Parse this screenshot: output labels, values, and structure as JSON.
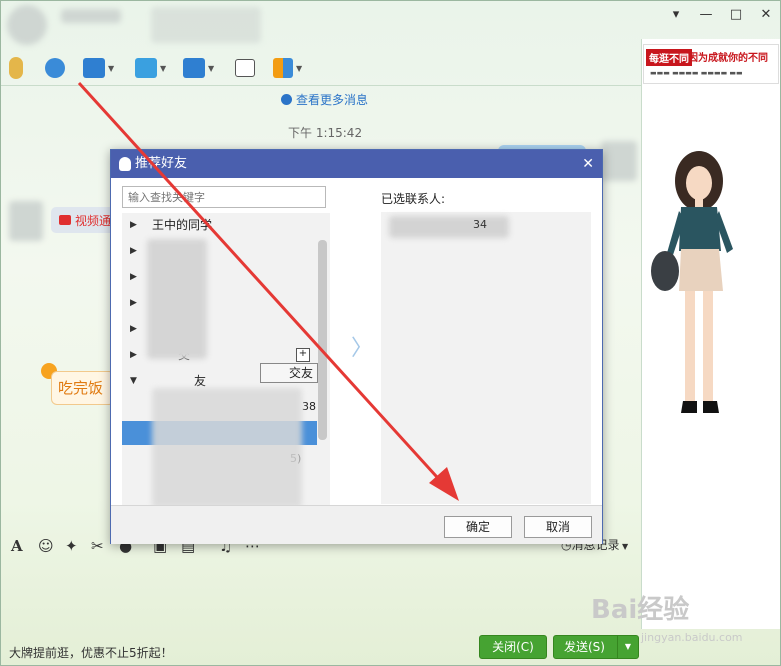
{
  "app": {
    "window_controls": {
      "dropdown": "▾",
      "minimize": "—",
      "maximize": "□",
      "close": "✕"
    }
  },
  "chat": {
    "more_messages": "查看更多消息",
    "timestamp": "下午 1:15:42",
    "video_msg": "视频通",
    "meal_msg": "吃完饭"
  },
  "input_toolbar": {
    "history_label": "消息记录"
  },
  "footer": {
    "promo": "大牌提前逛，优惠不止5折起！",
    "close_label": "关闭(C)",
    "send_label": "发送(S)"
  },
  "ad": {
    "tag": "每逛不同",
    "slogan": "因为成就你的不同"
  },
  "dialog": {
    "title": "推荐好友",
    "search_placeholder": "输入查找关键字",
    "groups": [
      {
        "label": "王中的同学",
        "expanded": false
      },
      {
        "label": "",
        "expanded": false
      },
      {
        "label": "",
        "expanded": false
      },
      {
        "label": "",
        "expanded": false
      },
      {
        "label": "友",
        "expanded": false
      },
      {
        "label": "交",
        "expanded": false
      },
      {
        "label": "友",
        "expanded": true
      }
    ],
    "contact_fragments": [
      "38",
      "5)"
    ],
    "add_friend_label": "交友",
    "selected_title": "已选联系人:",
    "selected_item": "34",
    "ok_label": "确定",
    "cancel_label": "取消"
  },
  "watermark": {
    "brand": "Bai经验",
    "site": "jingyan.baidu.com"
  },
  "colors": {
    "dialog_title_bg": "#4a5fae",
    "accent_blue": "#2b74c8",
    "send_green": "#46a332",
    "arrow_red": "#e53935"
  }
}
